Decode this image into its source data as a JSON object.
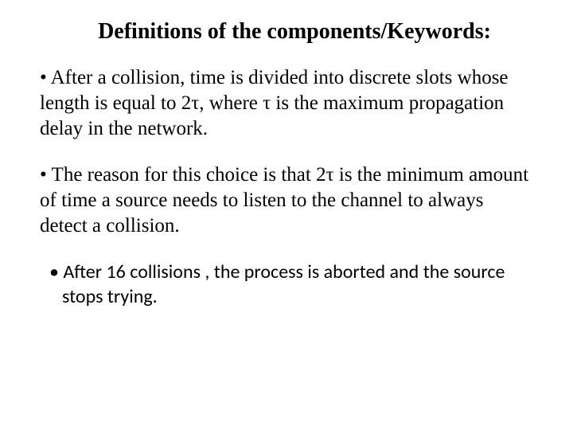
{
  "title": "Definitions of the components/Keywords:",
  "bullets": [
    "• After a collision, time is divided into discrete slots whose length is equal to 2τ,  where τ is the maximum propagation delay in the network.",
    "• The reason for this choice is that 2τ is the minimum amount of time a source needs to listen to the channel to always detect a collision.",
    "• After 16 collisions , the process is aborted and the source stops trying."
  ]
}
